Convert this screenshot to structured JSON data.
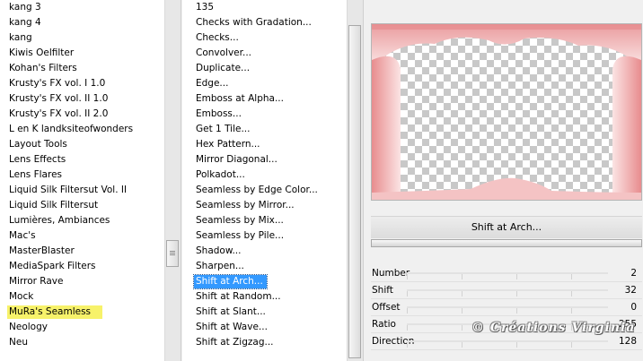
{
  "categories": {
    "items": [
      "kang 3",
      "kang 4",
      "kang",
      "Kiwis Oelfilter",
      "Kohan's Filters",
      "Krusty's FX vol. I 1.0",
      "Krusty's FX vol. II 1.0",
      "Krusty's FX vol. II 2.0",
      "L en K landksiteofwonders",
      "Layout Tools",
      "Lens Effects",
      "Lens Flares",
      "Liquid Silk Filtersut Vol. II",
      "Liquid Silk Filtersut",
      "Lumières, Ambiances",
      "Mac's",
      "MasterBlaster",
      "MediaSpark Filters",
      "Mirror Rave",
      "Mock",
      "MuRa's Seamless",
      "Neology",
      "Neu"
    ],
    "highlighted": "MuRa's Seamless",
    "highlight_color": "#f7f26a"
  },
  "filters": {
    "items": [
      "135",
      "Checks with Gradation...",
      "Checks...",
      "Convolver...",
      "Duplicate...",
      "Edge...",
      "Emboss at Alpha...",
      "Emboss...",
      "Get 1 Tile...",
      "Hex Pattern...",
      "Mirror Diagonal...",
      "Polkadot...",
      "Seamless by Edge Color...",
      "Seamless by Mirror...",
      "Seamless by Mix...",
      "Seamless by Pile...",
      "Shadow...",
      "Sharpen...",
      "Shift at Arch...",
      "Shift at Random...",
      "Shift at Slant...",
      "Shift at Wave...",
      "Shift at Zigzag..."
    ],
    "selected": "Shift at Arch...",
    "selection_color": "#3399ff"
  },
  "preview": {
    "frame_color": "#eda9aa"
  },
  "filter_name": "Shift at Arch...",
  "parameters": [
    {
      "name": "Number",
      "value": "2"
    },
    {
      "name": "Shift",
      "value": "32"
    },
    {
      "name": "Offset",
      "value": "0"
    },
    {
      "name": "Ratio",
      "value": "255"
    },
    {
      "name": "Direction",
      "value": "128"
    }
  ],
  "watermark": "© Créations Virginia"
}
